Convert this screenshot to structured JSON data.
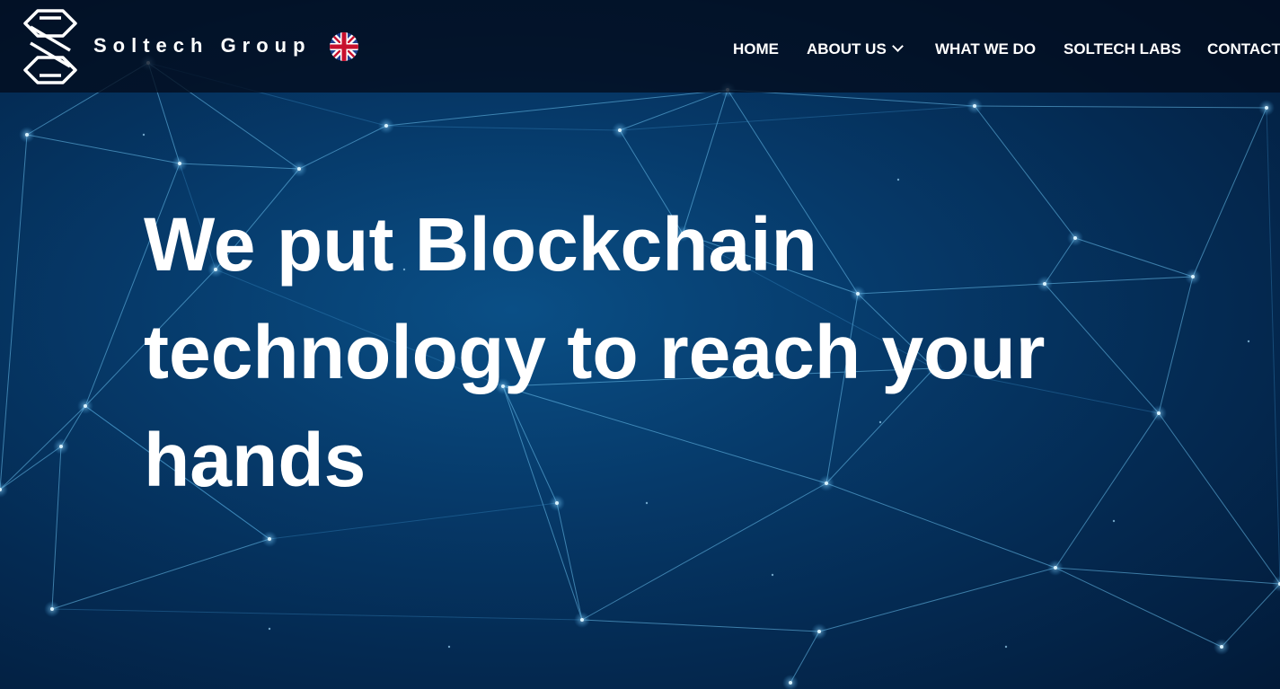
{
  "header": {
    "brand_name": "Soltech Group",
    "logo_icon": "soltech-s-logo",
    "language_flag": "uk-flag-icon"
  },
  "nav": {
    "items": [
      {
        "label": "HOME"
      },
      {
        "label": "ABOUT US",
        "has_dropdown": true
      },
      {
        "label": "WHAT WE DO"
      },
      {
        "label": "SOLTECH LABS"
      },
      {
        "label": "CONTACT"
      }
    ]
  },
  "hero": {
    "headline": "We put Blockchain technology to reach your hands"
  },
  "colors": {
    "background": "#063a6a",
    "header_bg": "#020c1c",
    "network_lines": "#5fb6e6",
    "text": "#ffffff"
  }
}
